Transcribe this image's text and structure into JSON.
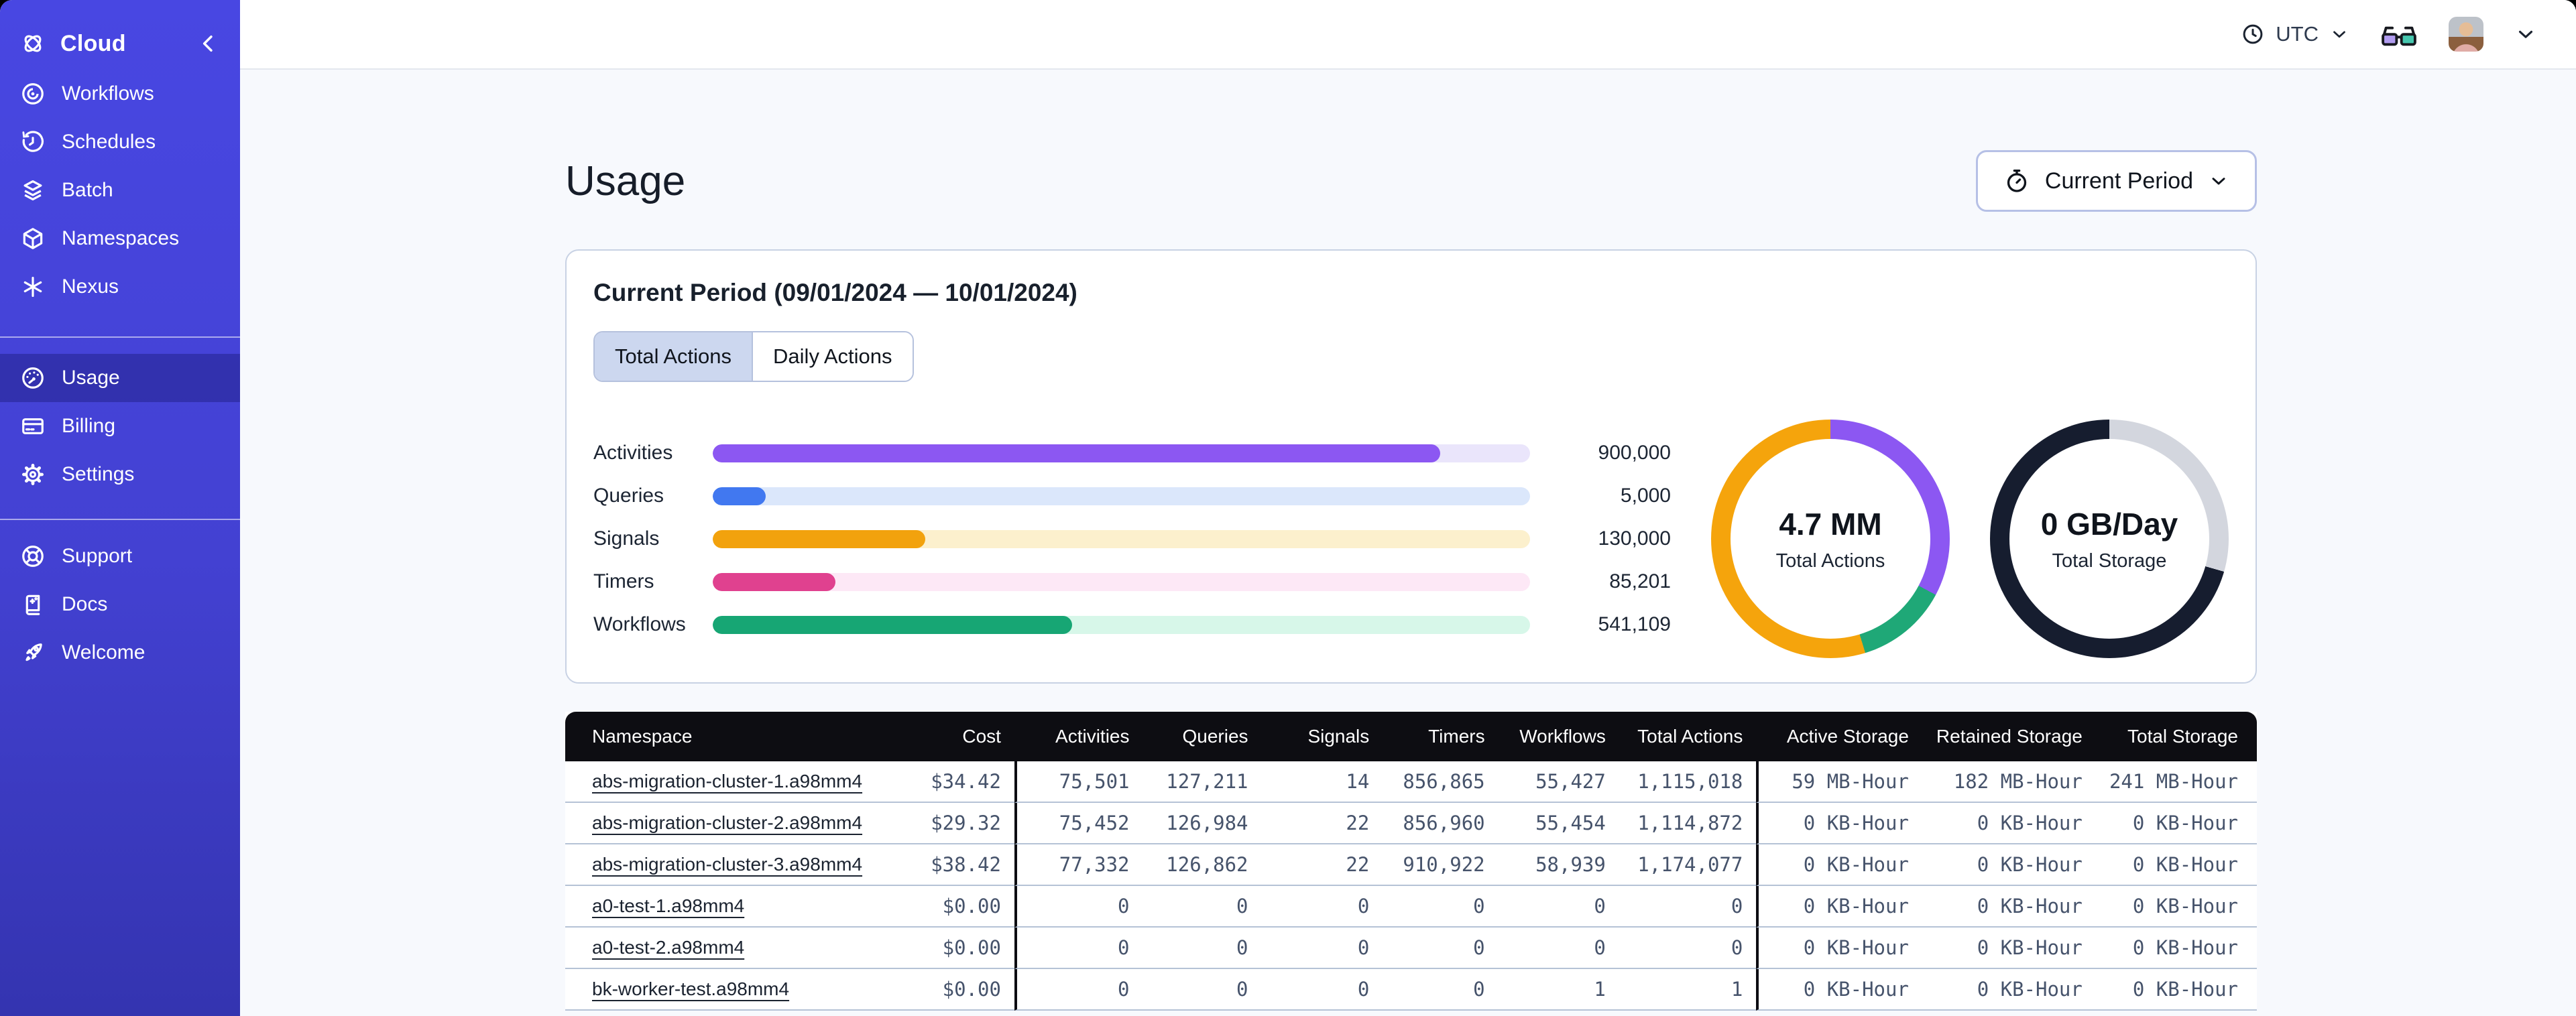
{
  "sidebar": {
    "brand": {
      "label": "Cloud"
    },
    "groups": [
      {
        "items": [
          {
            "label": "Workflows"
          },
          {
            "label": "Schedules"
          },
          {
            "label": "Batch"
          },
          {
            "label": "Namespaces"
          },
          {
            "label": "Nexus"
          }
        ]
      },
      {
        "items": [
          {
            "label": "Usage",
            "active": true
          },
          {
            "label": "Billing"
          },
          {
            "label": "Settings"
          }
        ]
      },
      {
        "items": [
          {
            "label": "Support"
          },
          {
            "label": "Docs"
          },
          {
            "label": "Welcome"
          }
        ]
      }
    ]
  },
  "topbar": {
    "timezone": "UTC"
  },
  "page": {
    "title": "Usage",
    "period_button_label": "Current Period"
  },
  "card": {
    "title": "Current Period (09/01/2024 — 10/01/2024)",
    "tabs": [
      {
        "label": "Total Actions",
        "active": true
      },
      {
        "label": "Daily Actions",
        "active": false
      }
    ]
  },
  "chart_data": [
    {
      "type": "bar",
      "orientation": "horizontal",
      "categories": [
        "Activities",
        "Queries",
        "Signals",
        "Timers",
        "Workflows"
      ],
      "values": [
        900000,
        5000,
        130000,
        85201,
        541109
      ],
      "value_labels": [
        "900,000",
        "5,000",
        "130,000",
        "85,201",
        "541,109"
      ],
      "fill_pct": [
        89,
        6.5,
        26,
        15,
        44
      ],
      "colors": [
        "#8c57f2",
        "#4178f0",
        "#f2a20d",
        "#e0418f",
        "#17a674"
      ],
      "track_colors": [
        "#eae5fb",
        "#dbe7fb",
        "#fcf0cd",
        "#fde8f6",
        "#d7f7e9"
      ]
    },
    {
      "type": "donut",
      "center_value": "4.7 MM",
      "center_label": "Total Actions",
      "segments": [
        {
          "color": "#8c57f2",
          "deg": 118
        },
        {
          "color": "#1fa877",
          "deg": 45
        },
        {
          "color": "#f5a40c",
          "deg": 197
        }
      ]
    },
    {
      "type": "donut",
      "center_value": "0 GB/Day",
      "center_label": "Total Storage",
      "segments": [
        {
          "color": "#d3d6de",
          "deg": 106
        },
        {
          "color": "#161d2f",
          "deg": 254
        }
      ]
    }
  ],
  "table": {
    "columns": [
      "Namespace",
      "Cost",
      "Activities",
      "Queries",
      "Signals",
      "Timers",
      "Workflows",
      "Total Actions",
      "Active Storage",
      "Retained Storage",
      "Total Storage"
    ],
    "rows": [
      {
        "namespace": "abs-migration-cluster-1.a98mm4",
        "cost": "$34.42",
        "activities": "75,501",
        "queries": "127,211",
        "signals": "14",
        "timers": "856,865",
        "workflows": "55,427",
        "total_actions": "1,115,018",
        "active_storage": "59 MB-Hour",
        "retained_storage": "182 MB-Hour",
        "total_storage": "241 MB-Hour"
      },
      {
        "namespace": "abs-migration-cluster-2.a98mm4",
        "cost": "$29.32",
        "activities": "75,452",
        "queries": "126,984",
        "signals": "22",
        "timers": "856,960",
        "workflows": "55,454",
        "total_actions": "1,114,872",
        "active_storage": "0 KB-Hour",
        "retained_storage": "0 KB-Hour",
        "total_storage": "0 KB-Hour"
      },
      {
        "namespace": "abs-migration-cluster-3.a98mm4",
        "cost": "$38.42",
        "activities": "77,332",
        "queries": "126,862",
        "signals": "22",
        "timers": "910,922",
        "workflows": "58,939",
        "total_actions": "1,174,077",
        "active_storage": "0 KB-Hour",
        "retained_storage": "0 KB-Hour",
        "total_storage": "0 KB-Hour"
      },
      {
        "namespace": "a0-test-1.a98mm4",
        "cost": "$0.00",
        "activities": "0",
        "queries": "0",
        "signals": "0",
        "timers": "0",
        "workflows": "0",
        "total_actions": "0",
        "active_storage": "0 KB-Hour",
        "retained_storage": "0 KB-Hour",
        "total_storage": "0 KB-Hour"
      },
      {
        "namespace": "a0-test-2.a98mm4",
        "cost": "$0.00",
        "activities": "0",
        "queries": "0",
        "signals": "0",
        "timers": "0",
        "workflows": "0",
        "total_actions": "0",
        "active_storage": "0 KB-Hour",
        "retained_storage": "0 KB-Hour",
        "total_storage": "0 KB-Hour"
      },
      {
        "namespace": "bk-worker-test.a98mm4",
        "cost": "$0.00",
        "activities": "0",
        "queries": "0",
        "signals": "0",
        "timers": "0",
        "workflows": "1",
        "total_actions": "1",
        "active_storage": "0 KB-Hour",
        "retained_storage": "0 KB-Hour",
        "total_storage": "0 KB-Hour"
      }
    ]
  },
  "icons": {
    "brand": "temporal-logo-icon",
    "collapse": "chevron-left-icon",
    "timezone": "clock-icon",
    "appearance": "glasses-icon",
    "account_menu": "chevron-down-icon",
    "period": "stopwatch-icon",
    "nav": [
      "workflows-icon",
      "schedules-icon",
      "batch-icon",
      "namespaces-icon",
      "nexus-icon",
      "usage-gauge-icon",
      "billing-card-icon",
      "settings-gear-icon",
      "support-lifebuoy-icon",
      "docs-book-icon",
      "welcome-rocket-icon"
    ]
  },
  "theme": {
    "sidebar_top": "#4847e2",
    "sidebar_bottom": "#3434b0",
    "content_bg": "#f7f9fd",
    "table_header_bg": "#0d0d12",
    "card_border": "#c8d2e4"
  }
}
